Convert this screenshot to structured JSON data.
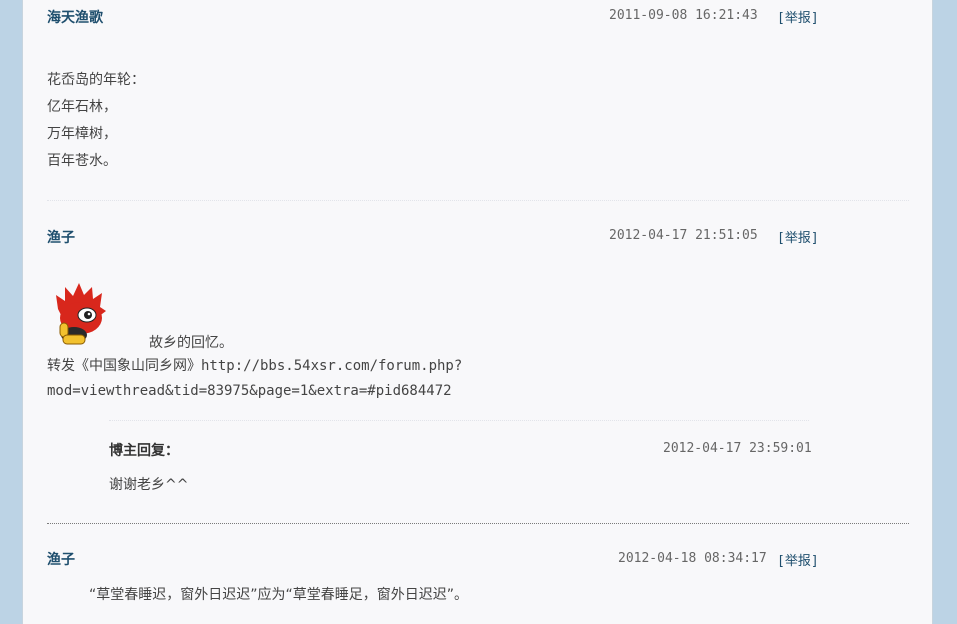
{
  "comments": [
    {
      "author": "海天渔歌",
      "time": "2011-09-08 16:21:43",
      "report": "[举报]",
      "lines": [
        "花岙岛的年轮：",
        "亿年石林，",
        "万年樟树，",
        "百年苍水。"
      ]
    },
    {
      "author": "渔子",
      "time": "2012-04-17 21:51:05",
      "report": "[举报]",
      "caption": "故乡的回忆。",
      "lines": [
        "转发《中国象山同乡网》http://bbs.54xsr.com/forum.php?",
        "mod=viewthread&tid=83975&page=1&extra=#pid684472"
      ],
      "reply": {
        "label": "博主回复：",
        "time": "2012-04-17 23:59:01",
        "text": "谢谢老乡^^"
      }
    },
    {
      "author": "渔子",
      "time": "2012-04-18 08:34:17",
      "report": "[举报]",
      "lines": [
        "“草堂春睡迟，窗外日迟迟”应为“草堂春睡足，窗外日迟迟”。"
      ]
    }
  ],
  "colors": {
    "background": "#bcd3e5",
    "panel": "#f8f8fa",
    "link": "#1f4f6e",
    "emoticon_red": "#d8271c"
  },
  "icons": {
    "emoticon": "red-mascot-thumbs-up-emoticon"
  }
}
